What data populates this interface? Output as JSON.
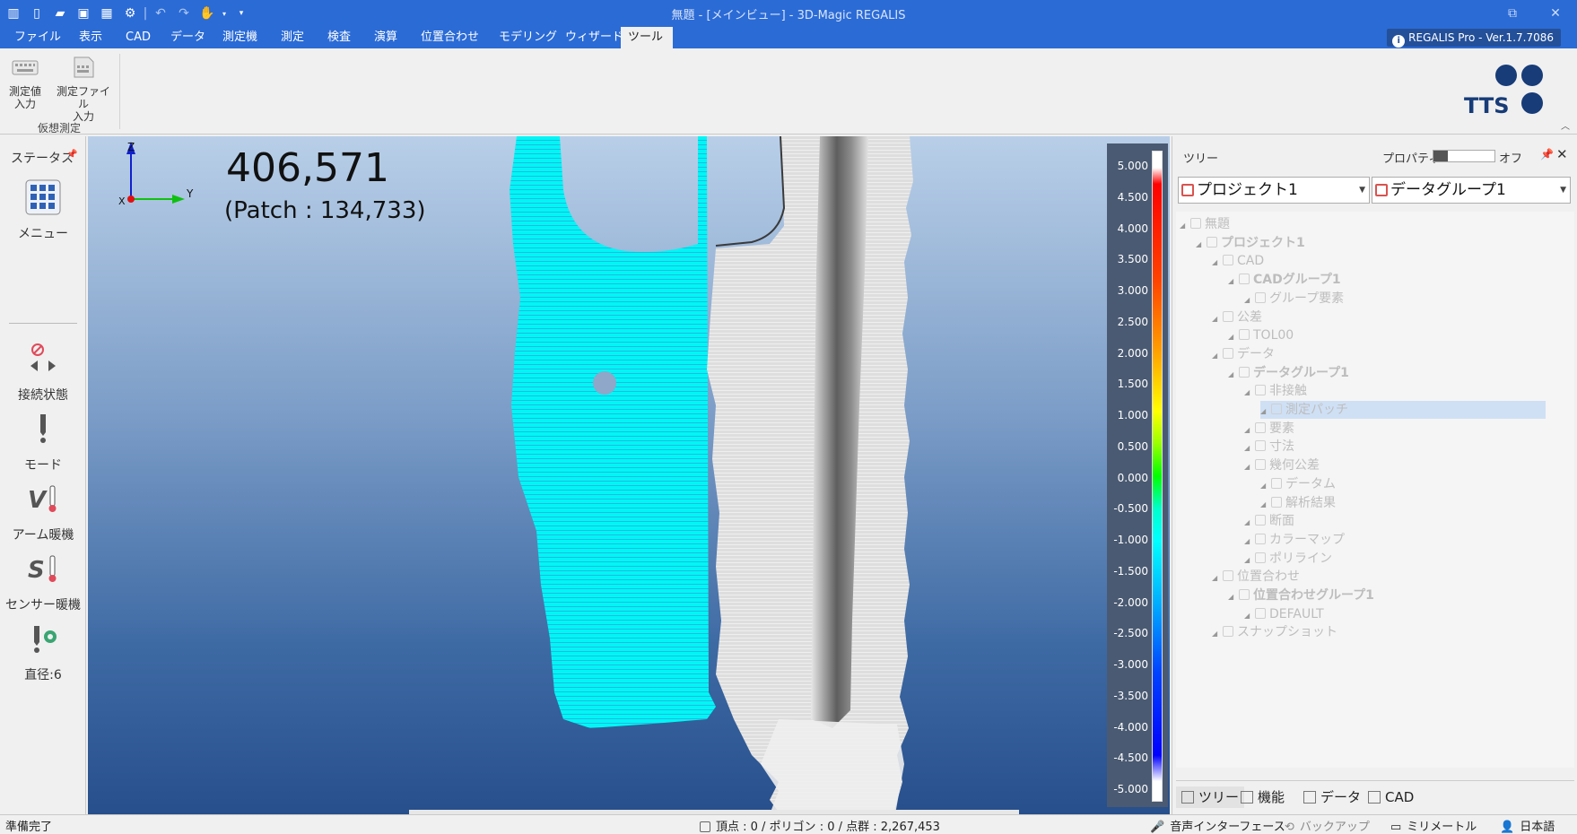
{
  "window": {
    "title": "無題 - [メインビュー] - 3D-Magic REGALIS",
    "quick_access_icons": [
      "app-logo-icon",
      "new-file-icon",
      "open-folder-icon",
      "save-icon",
      "grid-icon",
      "gear-icon",
      "undo-icon",
      "redo-icon",
      "hand-icon",
      "customize-icon"
    ]
  },
  "menu": {
    "tabs": [
      "ファイル",
      "表示",
      "CAD",
      "データ",
      "測定機",
      "測定",
      "検査",
      "演算",
      "位置合わせ",
      "モデリング",
      "ウィザード",
      "ツール"
    ],
    "active_tab": "ツール",
    "version": "REGALIS Pro - Ver.1.7.7086"
  },
  "ribbon": {
    "buttons": [
      {
        "label1": "測定値",
        "label2": "入力",
        "icon": "keyboard-icon"
      },
      {
        "label1": "測定ファイル",
        "label2": "入力",
        "icon": "file-input-icon"
      }
    ],
    "group_label": "仮想測定",
    "logo_text": "TTS"
  },
  "left_panel": {
    "title": "ステータス",
    "menu_label": "メニュー",
    "items": [
      {
        "label": "接続状態",
        "icon": "connection-icon"
      },
      {
        "label": "モード",
        "icon": "probe-mode-icon"
      },
      {
        "label": "アーム暖機",
        "icon": "arm-warmup-icon"
      },
      {
        "label": "センサー暖機",
        "icon": "sensor-warmup-icon"
      },
      {
        "label": "直径:6",
        "icon": "diameter-gear-icon"
      }
    ]
  },
  "viewport": {
    "point_count": "406,571",
    "patch_count": "(Patch : 134,733)",
    "axis_labels": {
      "z": "Z",
      "y": "Y",
      "x": "X"
    }
  },
  "color_scale": {
    "labels": [
      "5.000",
      "4.500",
      "4.000",
      "3.500",
      "3.000",
      "2.500",
      "2.000",
      "1.500",
      "1.000",
      "0.500",
      "0.000",
      "-0.500",
      "-1.000",
      "-1.500",
      "-2.000",
      "-2.500",
      "-3.000",
      "-3.500",
      "-4.000",
      "-4.500",
      "-5.000"
    ]
  },
  "right_panel": {
    "title": "ツリー",
    "property_label": "プロパティ",
    "toggle_state": "オフ",
    "combo_project": "プロジェクト1",
    "combo_group": "データグループ1",
    "tree": [
      {
        "label": "無題",
        "level": 0,
        "bold": false
      },
      {
        "label": "プロジェクト1",
        "level": 1,
        "bold": true
      },
      {
        "label": "CAD",
        "level": 2,
        "bold": false
      },
      {
        "label": "CADグループ1",
        "level": 3,
        "bold": true
      },
      {
        "label": "グループ要素",
        "level": 4,
        "bold": false
      },
      {
        "label": "公差",
        "level": 2,
        "bold": false
      },
      {
        "label": "TOL00",
        "level": 3,
        "bold": false
      },
      {
        "label": "データ",
        "level": 2,
        "bold": false
      },
      {
        "label": "データグループ1",
        "level": 3,
        "bold": true
      },
      {
        "label": "非接触",
        "level": 4,
        "bold": false
      },
      {
        "label": "測定パッチ",
        "level": 5,
        "bold": false,
        "selected": true
      },
      {
        "label": "要素",
        "level": 4,
        "bold": false
      },
      {
        "label": "寸法",
        "level": 4,
        "bold": false
      },
      {
        "label": "幾何公差",
        "level": 4,
        "bold": false
      },
      {
        "label": "データム",
        "level": 5,
        "bold": false
      },
      {
        "label": "解析結果",
        "level": 5,
        "bold": false
      },
      {
        "label": "断面",
        "level": 4,
        "bold": false
      },
      {
        "label": "カラーマップ",
        "level": 4,
        "bold": false
      },
      {
        "label": "ポリライン",
        "level": 4,
        "bold": false
      },
      {
        "label": "位置合わせ",
        "level": 2,
        "bold": false
      },
      {
        "label": "位置合わせグループ1",
        "level": 3,
        "bold": true
      },
      {
        "label": "DEFAULT",
        "level": 4,
        "bold": false
      },
      {
        "label": "スナップショット",
        "level": 2,
        "bold": false
      }
    ],
    "bottom_tabs": [
      "ツリー",
      "機能",
      "データ",
      "CAD"
    ],
    "active_bottom_tab": "ツリー"
  },
  "status_bar": {
    "left": "準備完了",
    "counts": "頂点 : 0 / ポリゴン : 0 / 点群 : 2,267,453",
    "voice": "音声インターフェース",
    "backup": "バックアップ",
    "unit": "ミリメートル",
    "language": "日本語"
  }
}
